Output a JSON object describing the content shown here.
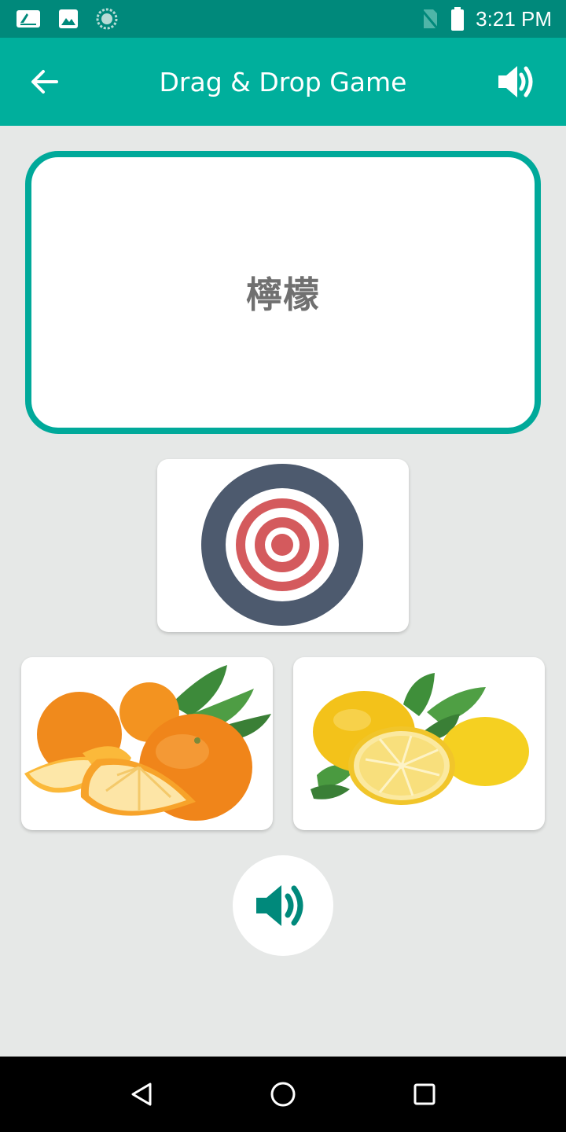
{
  "status_bar": {
    "time": "3:21 PM",
    "left_icons": [
      "notification-icon",
      "image-icon",
      "sync-icon"
    ],
    "right_icons": [
      "no-sim-icon",
      "battery-icon"
    ]
  },
  "app_bar": {
    "title": "Drag & Drop Game",
    "back_icon": "arrow-back-icon",
    "action_icon": "volume-icon"
  },
  "word_card": {
    "word": "檸檬"
  },
  "target": {
    "icon": "target-icon"
  },
  "options": [
    {
      "name": "orange",
      "icon": "orange-image"
    },
    {
      "name": "lemon",
      "icon": "lemon-image"
    }
  ],
  "sound_button": {
    "icon": "volume-icon"
  },
  "nav_bar": {
    "buttons": [
      "back-triangle-icon",
      "home-circle-icon",
      "recents-square-icon"
    ]
  },
  "colors": {
    "status_bar": "#00897b",
    "app_bar": "#00af9c",
    "card_border": "#00a99a",
    "background": "#e6e8e7",
    "sound_icon": "#00897b"
  }
}
